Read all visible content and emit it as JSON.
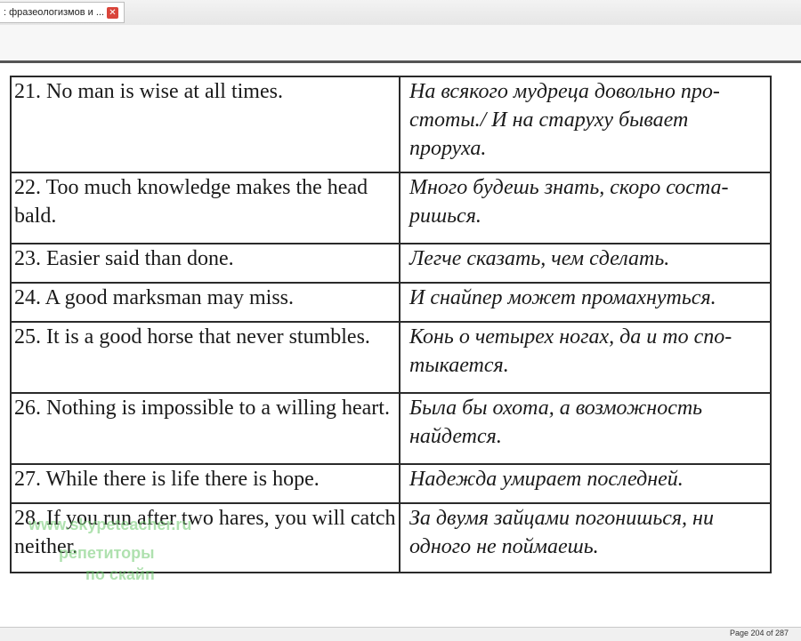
{
  "tab": {
    "title": ": фразеологизмов и ...",
    "close_label": "✕"
  },
  "rows": [
    {
      "en": "21. No man is wise at all times.",
      "ru": "На всякого мудреца довольно про-стоты./ И на старуху бывает проруха."
    },
    {
      "en": "22. Too much knowledge makes the head bald.",
      "ru": "Много будешь знать, скоро соста-ришься."
    },
    {
      "en": "23. Easier said than done.",
      "ru": "Легче сказать, чем сделать."
    },
    {
      "en": "24. A good marksman may miss.",
      "ru": "И снайпер может промахнуться."
    },
    {
      "en": "25. It is a good horse that never stumbles.",
      "ru": "Конь о четырех ногах, да и то спо-тыкается."
    },
    {
      "en": "26. Nothing is impossible to a willing heart.",
      "ru": "Была бы охота, а возможность найдется."
    },
    {
      "en": "27. While there is life there is hope.",
      "ru": "Надежда умирает последней."
    },
    {
      "en": "28. If you run after two hares, you will catch neither.",
      "ru": "За двумя зайцами погонишься, ни одного не поймаешь."
    }
  ],
  "watermark": {
    "line1": "www.skypeteacher.ru",
    "line2": "репетиторы",
    "line3": "по скайп"
  },
  "status": {
    "page_info": "Page 204 of 287"
  }
}
